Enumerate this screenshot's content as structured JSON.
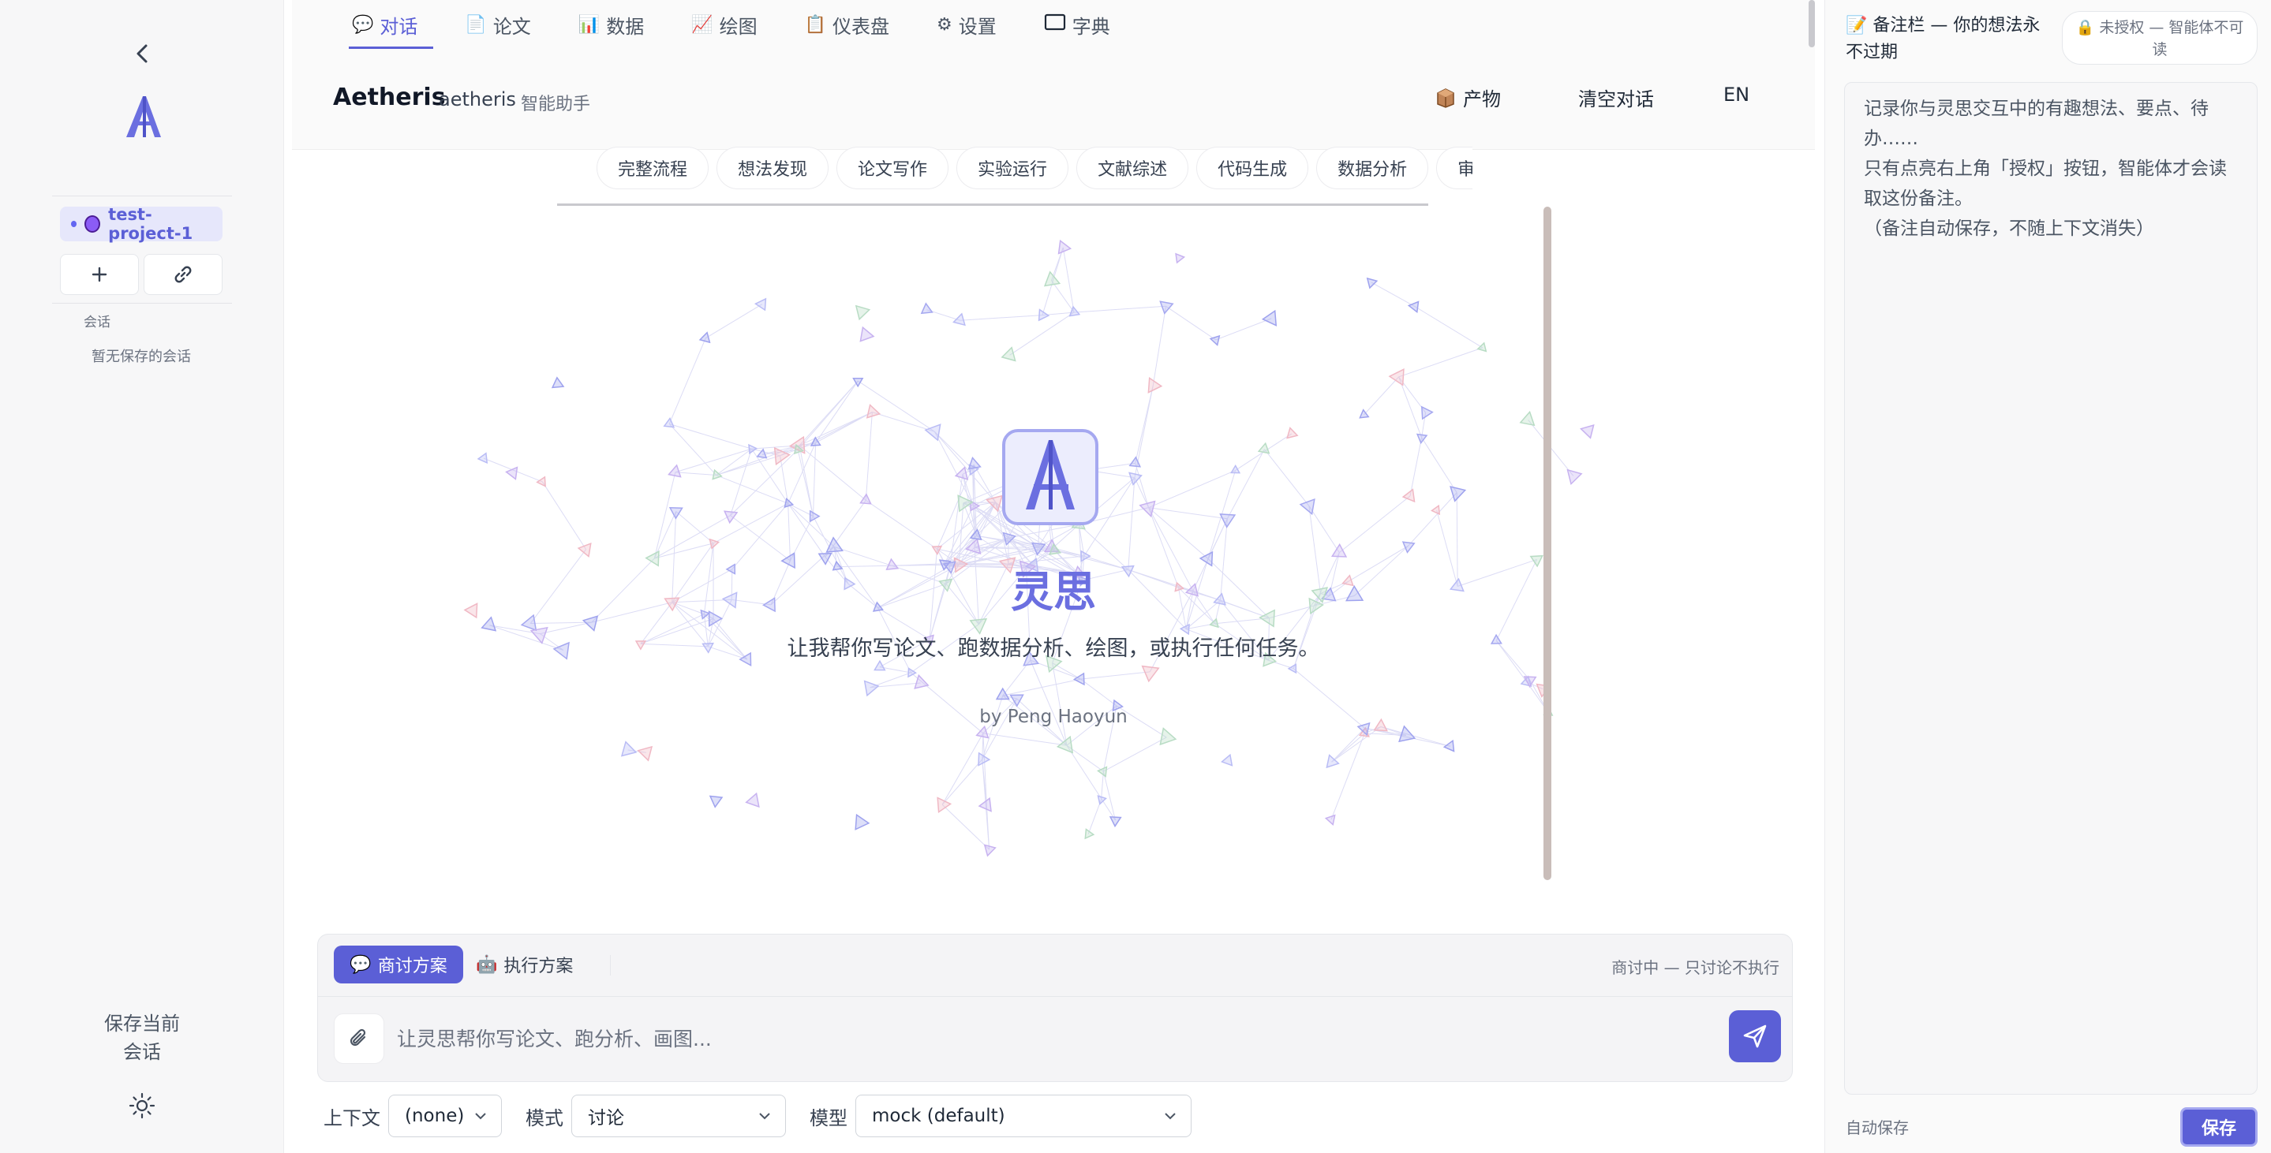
{
  "sidebar": {
    "project_name": "test-project-1",
    "section_label": "会话",
    "empty_text": "暂无保存的会话",
    "save_session": "保存当前会话"
  },
  "tabs": [
    {
      "icon": "💬",
      "label": "对话",
      "active": true
    },
    {
      "icon": "📄",
      "label": "论文"
    },
    {
      "icon": "📊",
      "label": "数据"
    },
    {
      "icon": "📈",
      "label": "绘图"
    },
    {
      "icon": "📋",
      "label": "仪表盘"
    },
    {
      "icon": "⚙",
      "label": "设置"
    },
    {
      "icon": "🖵",
      "label": "字典"
    }
  ],
  "header": {
    "title": "Aetheris",
    "subtitle": "aetheris",
    "role": "智能助手",
    "artifacts": "产物",
    "clear": "清空对话",
    "lang": "EN"
  },
  "quick_actions": [
    "完整流程",
    "想法发现",
    "论文写作",
    "实验运行",
    "文献综述",
    "代码生成",
    "数据分析",
    "审稿回复"
  ],
  "hero": {
    "name": "灵思",
    "desc": "让我帮你写论文、跑数据分析、绘图，或执行任何任务。",
    "by": "by Peng Haoyun"
  },
  "composer": {
    "mode_discuss": "商讨方案",
    "mode_execute": "执行方案",
    "status": "商讨中 — 只讨论不执行",
    "placeholder": "让灵思帮你写论文、跑分析、画图..."
  },
  "bottom": {
    "context_label": "上下文",
    "context_value": "(none)",
    "mode_label": "模式",
    "mode_value": "讨论",
    "model_label": "模型",
    "model_value": "mock (default)"
  },
  "notes": {
    "title": "备注栏 — 你的想法永不过期",
    "auth": "未授权 — 智能体不可读",
    "body": "记录你与灵思交互中的有趣想法、要点、待办……\n只有点亮右上角「授权」按钮，智能体才会读取这份备注。\n（备注自动保存，不随上下文消失）",
    "autosave": "自动保存",
    "save": "保存"
  },
  "colors": {
    "accent": "#5b5fd6",
    "accent_light": "#e6e7fb"
  }
}
